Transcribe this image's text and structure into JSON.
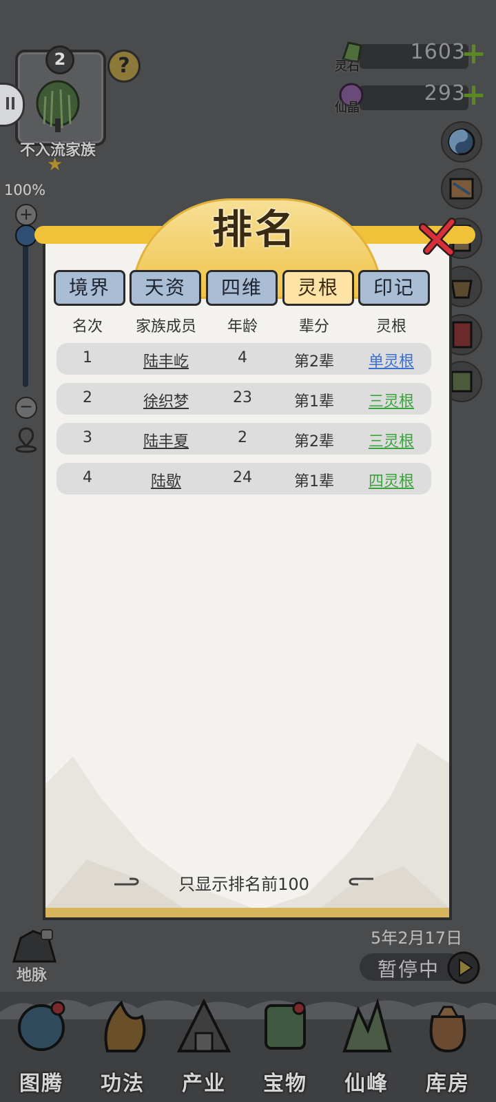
{
  "family": {
    "level": "2",
    "name": "不入流家族"
  },
  "currencies": [
    {
      "label": "灵石",
      "value": "1603"
    },
    {
      "label": "仙晶",
      "value": "293"
    }
  ],
  "zoom": {
    "percent": "100%",
    "level": 1.0
  },
  "dialog": {
    "title": "排名",
    "tabs": [
      "境界",
      "天资",
      "四维",
      "灵根",
      "印记"
    ],
    "active_tab": "灵根",
    "columns": [
      "名次",
      "家族成员",
      "年龄",
      "辈分",
      "灵根"
    ],
    "rows": [
      {
        "rank": "1",
        "name": "陆丰屹",
        "age": "4",
        "gen": "第2辈",
        "root": "单灵根"
      },
      {
        "rank": "2",
        "name": "徐织梦",
        "age": "23",
        "gen": "第1辈",
        "root": "三灵根"
      },
      {
        "rank": "3",
        "name": "陆丰夏",
        "age": "2",
        "gen": "第2辈",
        "root": "三灵根"
      },
      {
        "rank": "4",
        "name": "陆歇",
        "age": "24",
        "gen": "第1辈",
        "root": "四灵根"
      }
    ],
    "footer": "只显示排名前100"
  },
  "date": "5年2月17日",
  "pause_label": "暂停中",
  "earth_vein_label": "地脉",
  "nav": [
    "图腾",
    "功法",
    "产业",
    "宝物",
    "仙峰",
    "库房"
  ],
  "colors": {
    "single_root": "#3a6fd0",
    "triple_root": "#3aa23a",
    "quad_root": "#3aa23a",
    "accent": "#f0c23a"
  }
}
